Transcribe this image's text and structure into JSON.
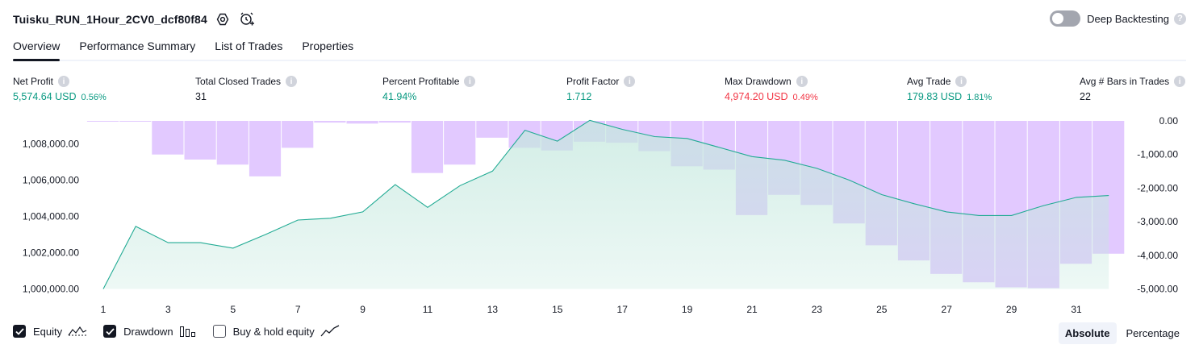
{
  "header": {
    "strategy_name": "Tuisku_RUN_1Hour_2CV0_dcf80f84",
    "icons": [
      "settings-icon",
      "add-alert-icon"
    ],
    "deep_backtesting_label": "Deep Backtesting",
    "deep_backtesting_enabled": false
  },
  "tabs": [
    {
      "label": "Overview",
      "active": true
    },
    {
      "label": "Performance Summary",
      "active": false
    },
    {
      "label": "List of Trades",
      "active": false
    },
    {
      "label": "Properties",
      "active": false
    }
  ],
  "stats": {
    "net_profit": {
      "label": "Net Profit",
      "value": "5,574.64 USD",
      "pct": "0.56%"
    },
    "total_closed_trades": {
      "label": "Total Closed Trades",
      "value": "31"
    },
    "percent_profitable": {
      "label": "Percent Profitable",
      "value": "41.94%"
    },
    "profit_factor": {
      "label": "Profit Factor",
      "value": "1.712"
    },
    "max_drawdown": {
      "label": "Max Drawdown",
      "value": "4,974.20 USD",
      "pct": "0.49%"
    },
    "avg_trade": {
      "label": "Avg Trade",
      "value": "179.83 USD",
      "pct": "1.81%"
    },
    "avg_bars": {
      "label": "Avg # Bars in Trades",
      "value": "22"
    }
  },
  "colors": {
    "profit": "#089981",
    "loss": "#f23645",
    "equity_line": "#22ab94",
    "equity_fill": "#c4e8de",
    "drawdown_bar": "#ddbfff",
    "text": "#131722"
  },
  "chart_data": {
    "type": "area",
    "x": [
      1,
      2,
      3,
      4,
      5,
      6,
      7,
      8,
      9,
      10,
      11,
      12,
      13,
      14,
      15,
      16,
      17,
      18,
      19,
      20,
      21,
      22,
      23,
      24,
      25,
      26,
      27,
      28,
      29,
      30,
      31,
      32
    ],
    "xticks": [
      "1",
      "3",
      "5",
      "7",
      "9",
      "11",
      "13",
      "15",
      "17",
      "19",
      "21",
      "23",
      "25",
      "27",
      "29",
      "31"
    ],
    "series": [
      {
        "name": "Equity",
        "axis": "left",
        "render": "line-area",
        "values": [
          1000000,
          1003450,
          1002550,
          1002550,
          1002250,
          1003000,
          1003800,
          1003900,
          1004250,
          1005750,
          1004500,
          1005700,
          1006500,
          1008750,
          1008150,
          1009300,
          1008800,
          1008400,
          1008300,
          1007800,
          1007300,
          1007100,
          1006650,
          1006000,
          1005200,
          1004700,
          1004250,
          1004050,
          1004050,
          1004600,
          1005050,
          1005150
        ]
      },
      {
        "name": "Drawdown",
        "axis": "right",
        "render": "bar",
        "values": [
          -20,
          -20,
          -1000,
          -1150,
          -1300,
          -1650,
          -800,
          -50,
          -80,
          -50,
          -1550,
          -1300,
          -500,
          -800,
          -880,
          -620,
          -650,
          -900,
          -1350,
          -1450,
          -2800,
          -2200,
          -2500,
          -3050,
          -3700,
          -4150,
          -4550,
          -4800,
          -4950,
          -4975,
          -4250,
          -3950
        ]
      }
    ],
    "y_left": {
      "ticks": [
        "1,000,000.00",
        "1,002,000.00",
        "1,004,000.00",
        "1,006,000.00",
        "1,008,000.00"
      ],
      "range": [
        1000000,
        1009300
      ]
    },
    "y_right": {
      "ticks": [
        "0.00",
        "-1,000.00",
        "-2,000.00",
        "-3,000.00",
        "-4,000.00",
        "-5,000.00"
      ],
      "range": [
        -5000,
        0
      ]
    }
  },
  "legend": {
    "items": [
      {
        "label": "Equity",
        "checked": true,
        "icon": "equity-line-icon"
      },
      {
        "label": "Drawdown",
        "checked": true,
        "icon": "drawdown-bars-icon"
      },
      {
        "label": "Buy & hold equity",
        "checked": false,
        "icon": "buy-hold-line-icon"
      }
    ]
  },
  "display_modes": {
    "absolute": "Absolute",
    "percentage": "Percentage",
    "active": "Absolute"
  }
}
